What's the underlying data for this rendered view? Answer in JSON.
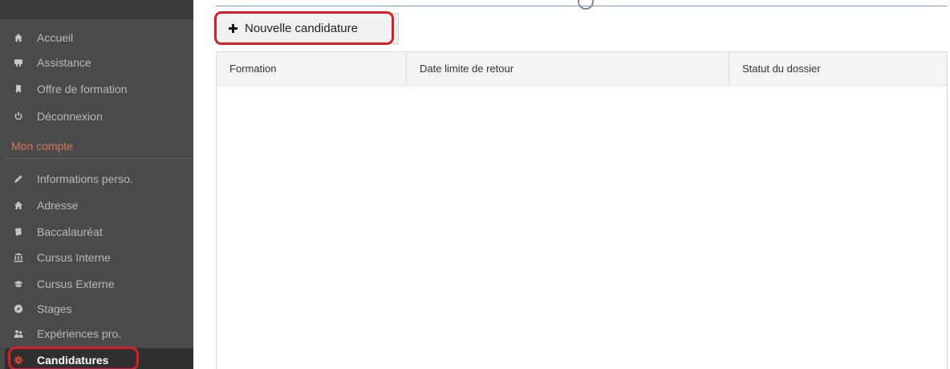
{
  "sidebar": {
    "items": [
      {
        "label": "Accueil",
        "icon": "home-icon"
      },
      {
        "label": "Assistance",
        "icon": "support-icon"
      },
      {
        "label": "Offre de formation",
        "icon": "bookmark-icon"
      },
      {
        "label": "Déconnexion",
        "icon": "power-icon"
      }
    ],
    "section": "Mon compte",
    "account_items": [
      {
        "label": "Informations perso.",
        "icon": "pencil-icon"
      },
      {
        "label": "Adresse",
        "icon": "home-icon"
      },
      {
        "label": "Baccalauréat",
        "icon": "book-icon"
      },
      {
        "label": "Cursus Interne",
        "icon": "institution-icon"
      },
      {
        "label": "Cursus Externe",
        "icon": "graduation-cap-icon"
      },
      {
        "label": "Stages",
        "icon": "compass-icon"
      },
      {
        "label": "Expériences pro.",
        "icon": "people-icon"
      },
      {
        "label": "Candidatures",
        "icon": "gear-icon",
        "active": true
      }
    ]
  },
  "toolbar": {
    "new_application_label": "Nouvelle candidature"
  },
  "table": {
    "columns": [
      "Formation",
      "Date limite de retour",
      "Statut du dossier"
    ],
    "rows": []
  },
  "colors": {
    "sidebar_bg": "#4a4a4a",
    "section_heading": "#d4785a",
    "highlight_ring": "#d91f26",
    "active_icon": "#d9473a"
  }
}
